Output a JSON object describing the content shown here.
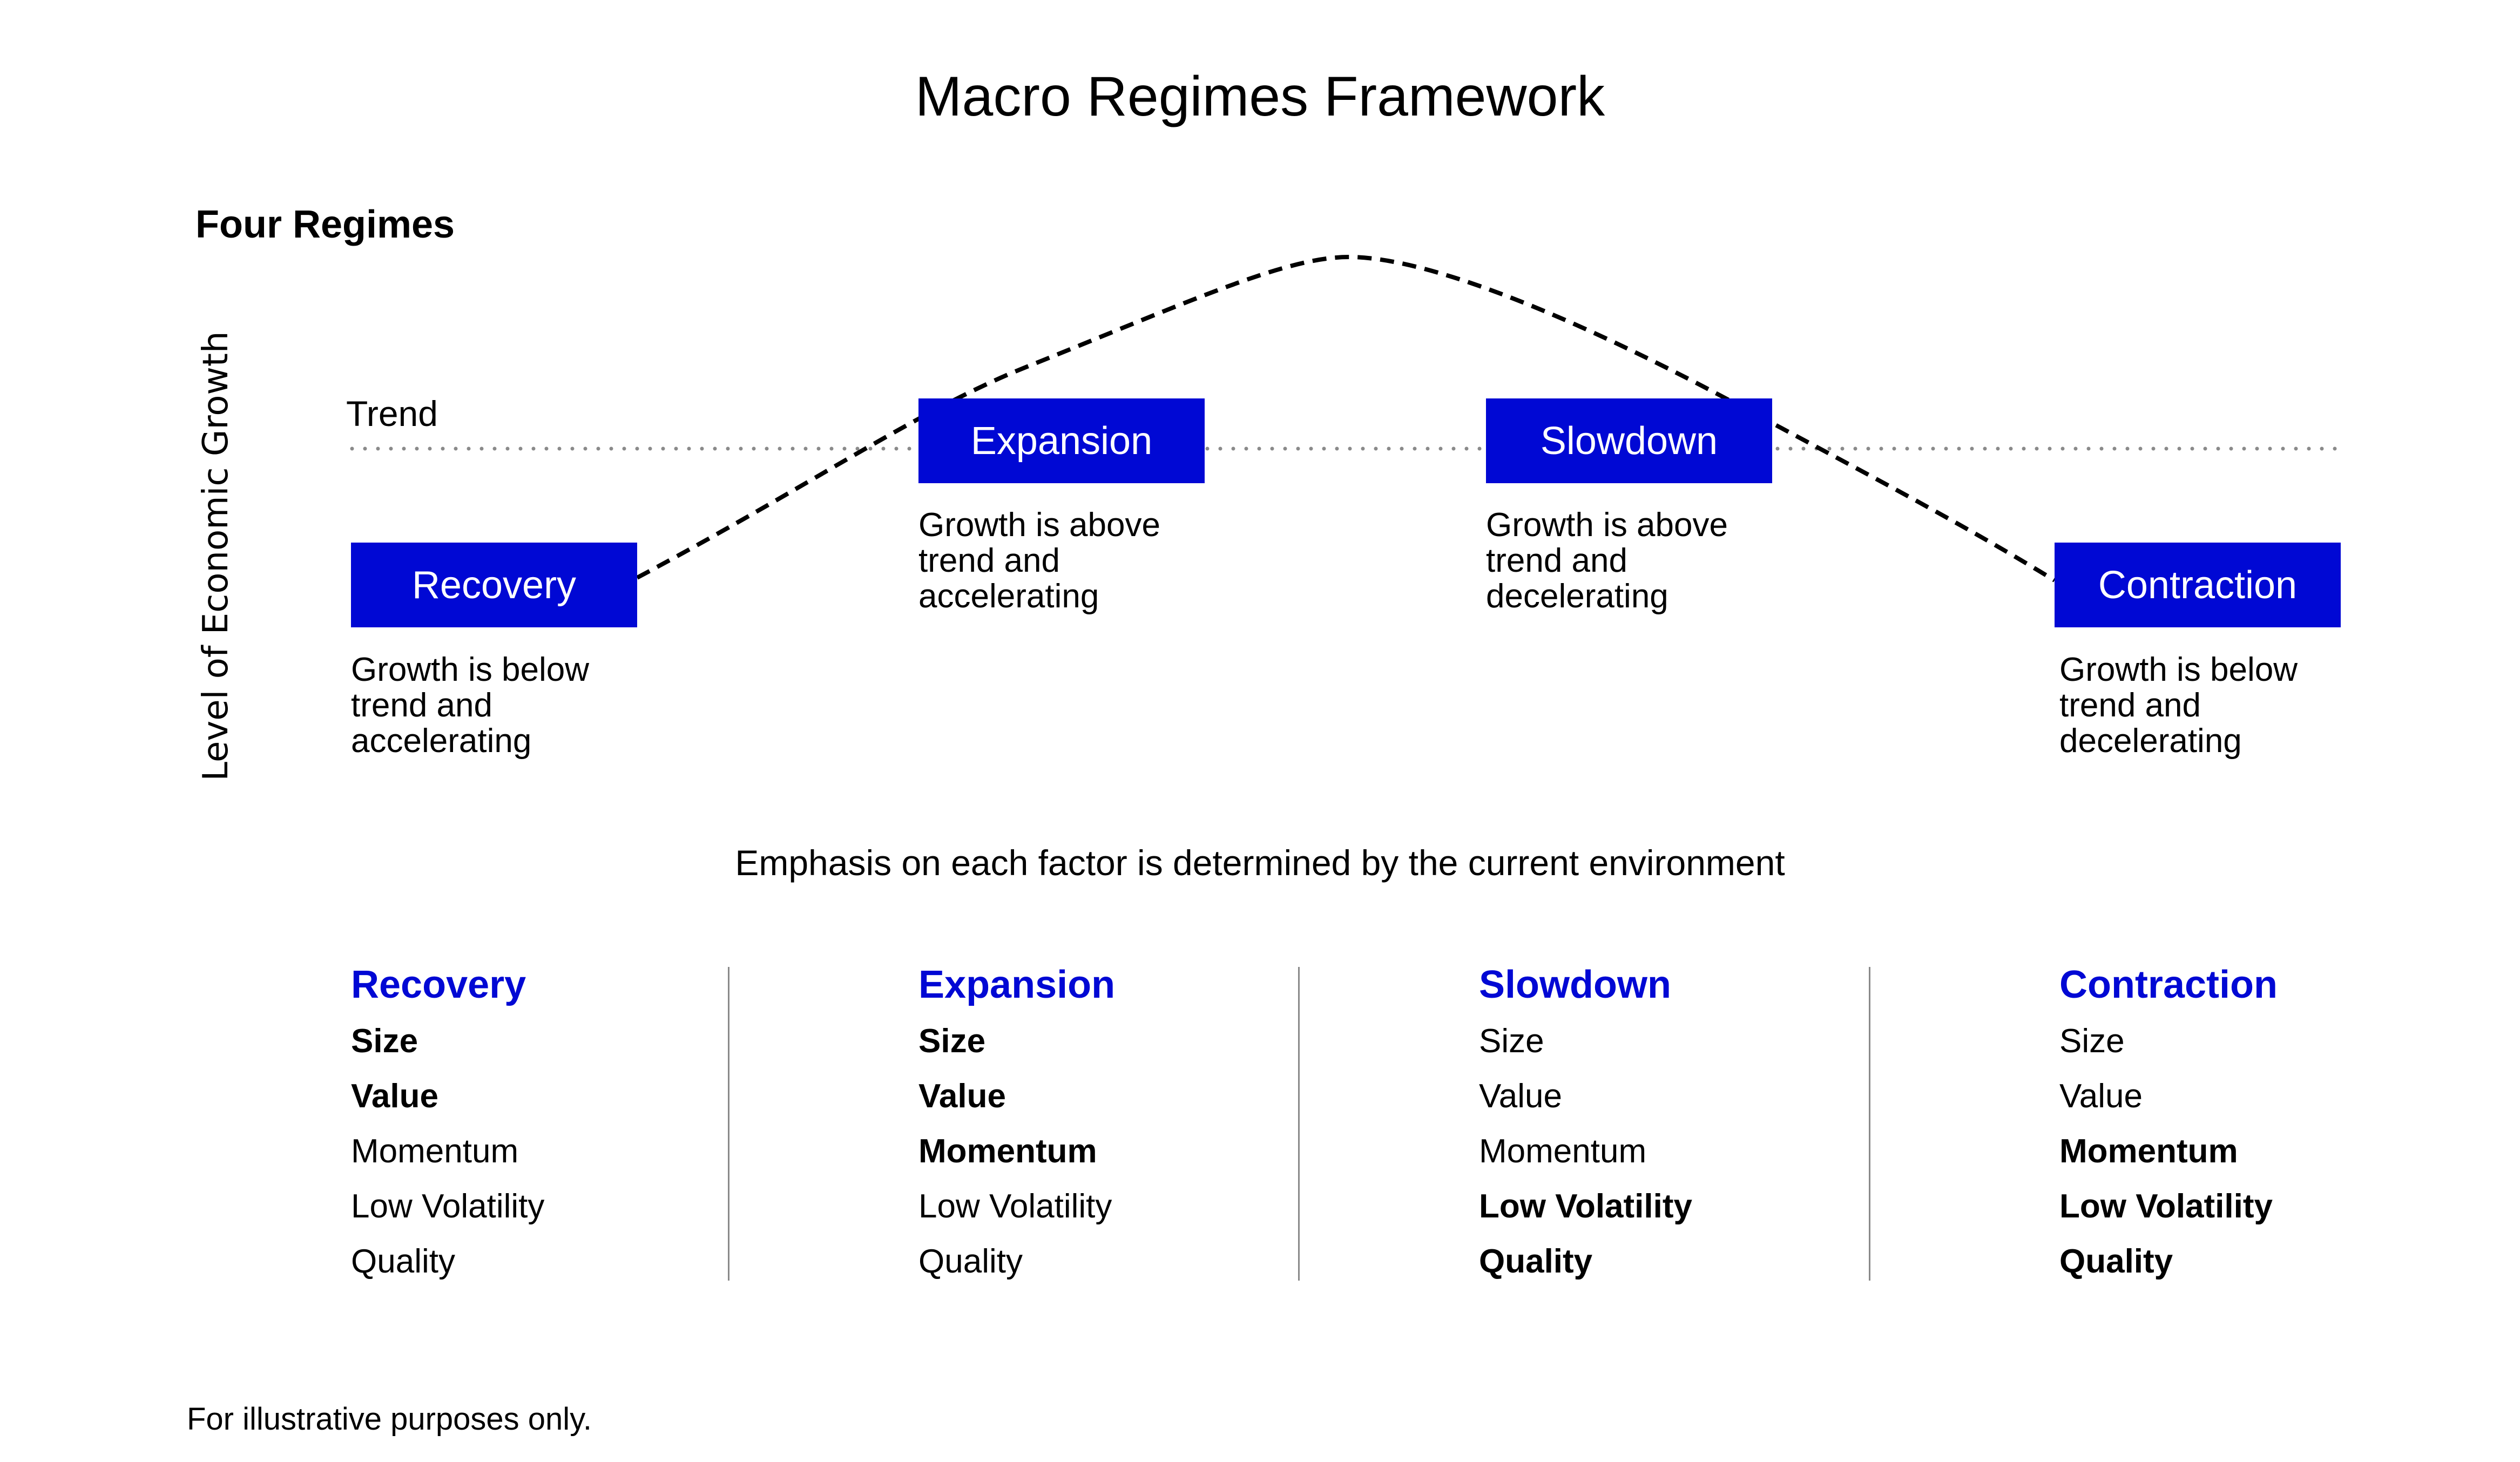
{
  "title": "Macro Regimes Framework",
  "subtitle": "Four Regimes",
  "y_axis_label": "Level of Economic Growth",
  "trend_label": "Trend",
  "colors": {
    "accent": "#0008D4",
    "trend_dots": "#8a8a8a",
    "curve": "#000000"
  },
  "regimes": [
    {
      "name": "Recovery",
      "position": "below",
      "description": [
        "Growth is below",
        "trend and",
        "accelerating"
      ]
    },
    {
      "name": "Expansion",
      "position": "above",
      "description": [
        "Growth is above",
        "trend and",
        "accelerating"
      ]
    },
    {
      "name": "Slowdown",
      "position": "above",
      "description": [
        "Growth is above",
        "trend and",
        "decelerating"
      ]
    },
    {
      "name": "Contraction",
      "position": "below",
      "description": [
        "Growth is below",
        "trend and",
        "decelerating"
      ]
    }
  ],
  "emphasis_text": "Emphasis on each factor is determined by the current environment",
  "factor_table": [
    {
      "regime": "Recovery",
      "factors": [
        {
          "name": "Size",
          "emphasized": true
        },
        {
          "name": "Value",
          "emphasized": true
        },
        {
          "name": "Momentum",
          "emphasized": false
        },
        {
          "name": "Low Volatility",
          "emphasized": false
        },
        {
          "name": "Quality",
          "emphasized": false
        }
      ]
    },
    {
      "regime": "Expansion",
      "factors": [
        {
          "name": "Size",
          "emphasized": true
        },
        {
          "name": "Value",
          "emphasized": true
        },
        {
          "name": "Momentum",
          "emphasized": true
        },
        {
          "name": "Low Volatility",
          "emphasized": false
        },
        {
          "name": "Quality",
          "emphasized": false
        }
      ]
    },
    {
      "regime": "Slowdown",
      "factors": [
        {
          "name": "Size",
          "emphasized": false
        },
        {
          "name": "Value",
          "emphasized": false
        },
        {
          "name": "Momentum",
          "emphasized": false
        },
        {
          "name": "Low Volatility",
          "emphasized": true
        },
        {
          "name": "Quality",
          "emphasized": true
        }
      ]
    },
    {
      "regime": "Contraction",
      "factors": [
        {
          "name": "Size",
          "emphasized": false
        },
        {
          "name": "Value",
          "emphasized": false
        },
        {
          "name": "Momentum",
          "emphasized": true
        },
        {
          "name": "Low Volatility",
          "emphasized": true
        },
        {
          "name": "Quality",
          "emphasized": true
        }
      ]
    }
  ],
  "footnote": "For illustrative purposes only."
}
